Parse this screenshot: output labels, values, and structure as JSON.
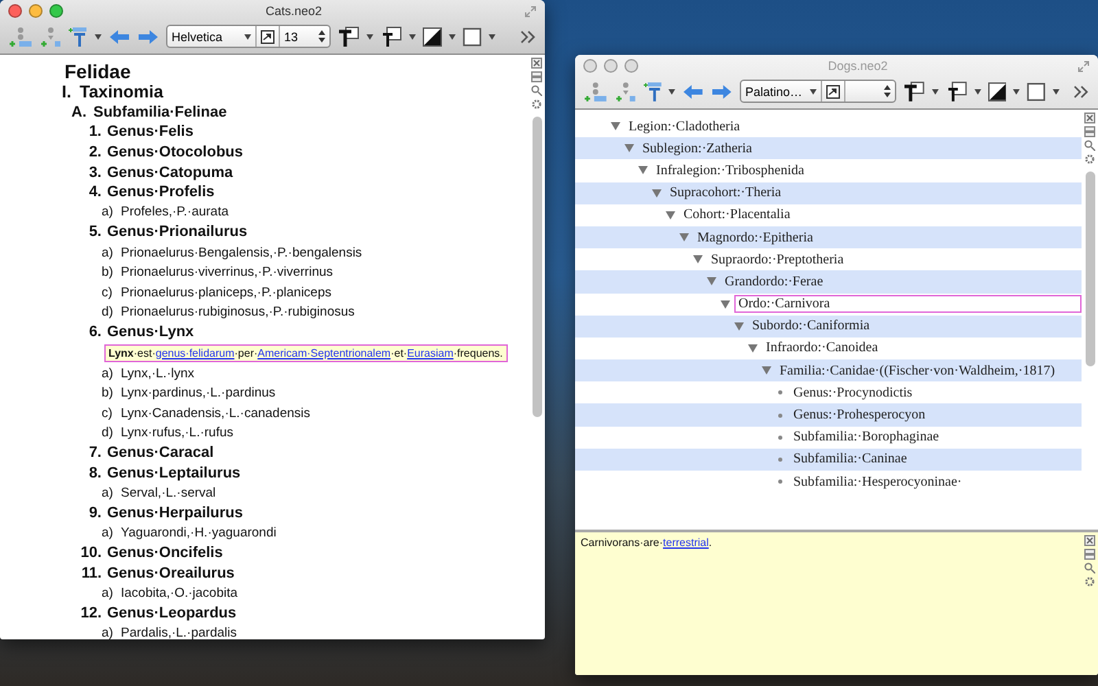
{
  "windows": [
    {
      "title": "Cats.neo2",
      "toolbar": {
        "font": "Helvetica",
        "size": "13"
      },
      "outline": [
        {
          "label": "Felidae",
          "children": [
            {
              "marker": "I.",
              "label": "Taxinomia",
              "children": [
                {
                  "marker": "A.",
                  "label": "Subfamilia·Felinae",
                  "children": [
                    {
                      "marker": "1.",
                      "label": "Genus·Felis"
                    },
                    {
                      "marker": "2.",
                      "label": "Genus·Otocolobus"
                    },
                    {
                      "marker": "3.",
                      "label": "Genus·Catopuma"
                    },
                    {
                      "marker": "4.",
                      "label": "Genus·Profelis",
                      "children": [
                        {
                          "marker": "a)",
                          "label": "Profeles,·P.·aurata"
                        }
                      ]
                    },
                    {
                      "marker": "5.",
                      "label": "Genus·Prionailurus",
                      "children": [
                        {
                          "marker": "a)",
                          "label": "Prionaelurus·Bengalensis,·P.·bengalensis"
                        },
                        {
                          "marker": "b)",
                          "label": "Prionaelurus·viverrinus,·P.·viverrinus"
                        },
                        {
                          "marker": "c)",
                          "label": "Prionaelurus·planiceps,·P.·planiceps"
                        },
                        {
                          "marker": "d)",
                          "label": "Prionaelurus·rubiginosus,·P.·rubiginosus"
                        }
                      ]
                    },
                    {
                      "marker": "6.",
                      "label": "Genus·Lynx",
                      "note": [
                        {
                          "kind": "bold",
                          "text": "Lynx"
                        },
                        {
                          "kind": "plain",
                          "text": "·est·"
                        },
                        {
                          "kind": "link",
                          "text": "genus·felidarum"
                        },
                        {
                          "kind": "plain",
                          "text": "·per·"
                        },
                        {
                          "kind": "link",
                          "text": "Americam·Septentrionalem"
                        },
                        {
                          "kind": "plain",
                          "text": "·et·"
                        },
                        {
                          "kind": "link",
                          "text": "Eurasiam"
                        },
                        {
                          "kind": "plain",
                          "text": "·frequens."
                        }
                      ],
                      "children": [
                        {
                          "marker": "a)",
                          "label": "Lynx,·L.·lynx"
                        },
                        {
                          "marker": "b)",
                          "label": "Lynx·pardinus,·L.·pardinus"
                        },
                        {
                          "marker": "c)",
                          "label": "Lynx·Canadensis,·L.·canadensis"
                        },
                        {
                          "marker": "d)",
                          "label": "Lynx·rufus,·L.·rufus"
                        }
                      ]
                    },
                    {
                      "marker": "7.",
                      "label": "Genus·Caracal"
                    },
                    {
                      "marker": "8.",
                      "label": "Genus·Leptailurus",
                      "children": [
                        {
                          "marker": "a)",
                          "label": "Serval,·L.·serval"
                        }
                      ]
                    },
                    {
                      "marker": "9.",
                      "label": "Genus·Herpailurus",
                      "children": [
                        {
                          "marker": "a)",
                          "label": "Yaguarondi,·H.·yaguarondi"
                        }
                      ]
                    },
                    {
                      "marker": "10.",
                      "label": "Genus·Oncifelis"
                    },
                    {
                      "marker": "11.",
                      "label": "Genus·Oreailurus",
                      "children": [
                        {
                          "marker": "a)",
                          "label": "Iacobita,·O.·jacobita"
                        }
                      ]
                    },
                    {
                      "marker": "12.",
                      "label": "Genus·Leopardus",
                      "children": [
                        {
                          "marker": "a)",
                          "label": "Pardalis,·L.·pardalis"
                        }
                      ]
                    }
                  ]
                }
              ]
            }
          ]
        }
      ]
    },
    {
      "title": "Dogs.neo2",
      "toolbar": {
        "font": "Palatino…"
      },
      "outline": [
        {
          "label": "Legion:·Cladotheria",
          "selected": false,
          "children": [
            {
              "label": "Sublegion:·Zatheria",
              "selected": false,
              "children": [
                {
                  "label": "Infralegion:·Tribosphenida",
                  "selected": false,
                  "children": [
                    {
                      "label": "Supracohort:·Theria",
                      "selected": false,
                      "children": [
                        {
                          "label": "Cohort:·Placentalia",
                          "selected": false,
                          "children": [
                            {
                              "label": "Magnordo:·Epitheria",
                              "selected": false,
                              "children": [
                                {
                                  "label": "Supraordo:·Preptotheria",
                                  "selected": false,
                                  "children": [
                                    {
                                      "label": "Grandordo:·Ferae",
                                      "selected": false,
                                      "children": [
                                        {
                                          "label": "Ordo:·Carnivora",
                                          "selected": true,
                                          "children": [
                                            {
                                              "label": "Subordo:·Caniformia",
                                              "selected": false,
                                              "children": [
                                                {
                                                  "label": "Infraordo:·Canoidea",
                                                  "selected": false,
                                                  "children": [
                                                    {
                                                      "label": "Familia:·Canidae·((Fischer·von·Waldheim,·1817)",
                                                      "selected": false,
                                                      "children": [
                                                        {
                                                          "label": "Genus:·Procynodictis",
                                                          "selected": false
                                                        },
                                                        {
                                                          "label": "Genus:·Prohesperocyon",
                                                          "selected": false
                                                        },
                                                        {
                                                          "label": "Subfamilia:·Borophaginae",
                                                          "selected": false
                                                        },
                                                        {
                                                          "label": "Subfamilia:·Caninae",
                                                          "selected": false
                                                        },
                                                        {
                                                          "label": "Subfamilia:·Hesperocyoninae·",
                                                          "selected": false
                                                        }
                                                      ]
                                                    }
                                                  ]
                                                }
                                              ]
                                            }
                                          ]
                                        }
                                      ]
                                    }
                                  ]
                                }
                              ]
                            }
                          ]
                        }
                      ]
                    }
                  ]
                }
              ]
            }
          ]
        }
      ],
      "note": [
        {
          "kind": "plain",
          "text": "Carnivorans·are·"
        },
        {
          "kind": "link",
          "text": "terrestrial"
        },
        {
          "kind": "plain",
          "text": "."
        }
      ]
    }
  ]
}
